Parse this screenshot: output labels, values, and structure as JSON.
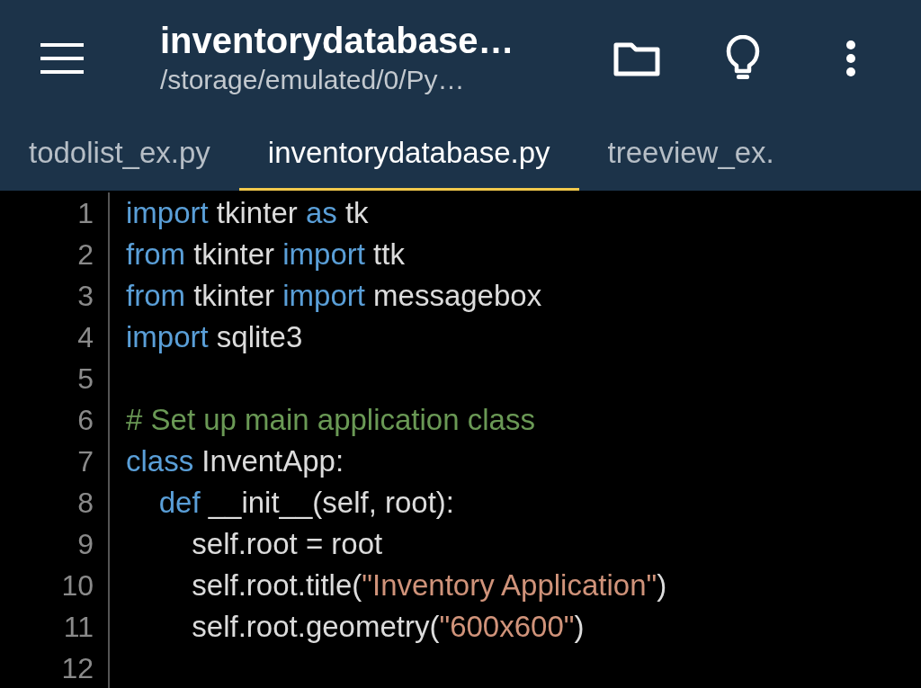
{
  "header": {
    "title": "inventorydatabase…",
    "subtitle": "/storage/emulated/0/Py…"
  },
  "tabs": [
    {
      "label": "todolist_ex.py",
      "selected": false
    },
    {
      "label": "inventorydatabase.py",
      "selected": true
    },
    {
      "label": "treeview_ex.",
      "selected": false
    }
  ],
  "code": [
    {
      "number": "1",
      "tokens": [
        {
          "kind": "keyword",
          "text": "import"
        },
        {
          "kind": "plain",
          "text": " tkinter "
        },
        {
          "kind": "keyword",
          "text": "as"
        },
        {
          "kind": "plain",
          "text": " tk"
        }
      ]
    },
    {
      "number": "2",
      "tokens": [
        {
          "kind": "keyword",
          "text": "from"
        },
        {
          "kind": "plain",
          "text": " tkinter "
        },
        {
          "kind": "keyword",
          "text": "import"
        },
        {
          "kind": "plain",
          "text": " ttk"
        }
      ]
    },
    {
      "number": "3",
      "tokens": [
        {
          "kind": "keyword",
          "text": "from"
        },
        {
          "kind": "plain",
          "text": " tkinter "
        },
        {
          "kind": "keyword",
          "text": "import"
        },
        {
          "kind": "plain",
          "text": " messagebox"
        }
      ]
    },
    {
      "number": "4",
      "tokens": [
        {
          "kind": "keyword",
          "text": "import"
        },
        {
          "kind": "plain",
          "text": " sqlite3"
        }
      ]
    },
    {
      "number": "5"
    },
    {
      "number": "6",
      "tokens": [
        {
          "kind": "comment",
          "text": "# Set up main application class"
        }
      ]
    },
    {
      "number": "7",
      "tokens": [
        {
          "kind": "keyword",
          "text": "class"
        },
        {
          "kind": "plain",
          "text": " InventApp:"
        }
      ]
    },
    {
      "number": "8",
      "tokens": [
        {
          "kind": "keyword",
          "text": "    def"
        },
        {
          "kind": "plain",
          "text": " __init__(self, root):"
        }
      ]
    },
    {
      "number": "9",
      "tokens": [
        {
          "kind": "plain",
          "text": "        self.root = root"
        }
      ]
    },
    {
      "number": "10",
      "tokens": [
        {
          "kind": "plain",
          "text": "        self.root.title("
        },
        {
          "kind": "string",
          "text": "\"Inventory Application\""
        },
        {
          "kind": "plain",
          "text": ")"
        }
      ]
    },
    {
      "number": "11",
      "tokens": [
        {
          "kind": "plain",
          "text": "        self.root.geometry("
        },
        {
          "kind": "string",
          "text": "\"600x600\""
        },
        {
          "kind": "plain",
          "text": ")"
        }
      ]
    },
    {
      "number": "12"
    }
  ]
}
